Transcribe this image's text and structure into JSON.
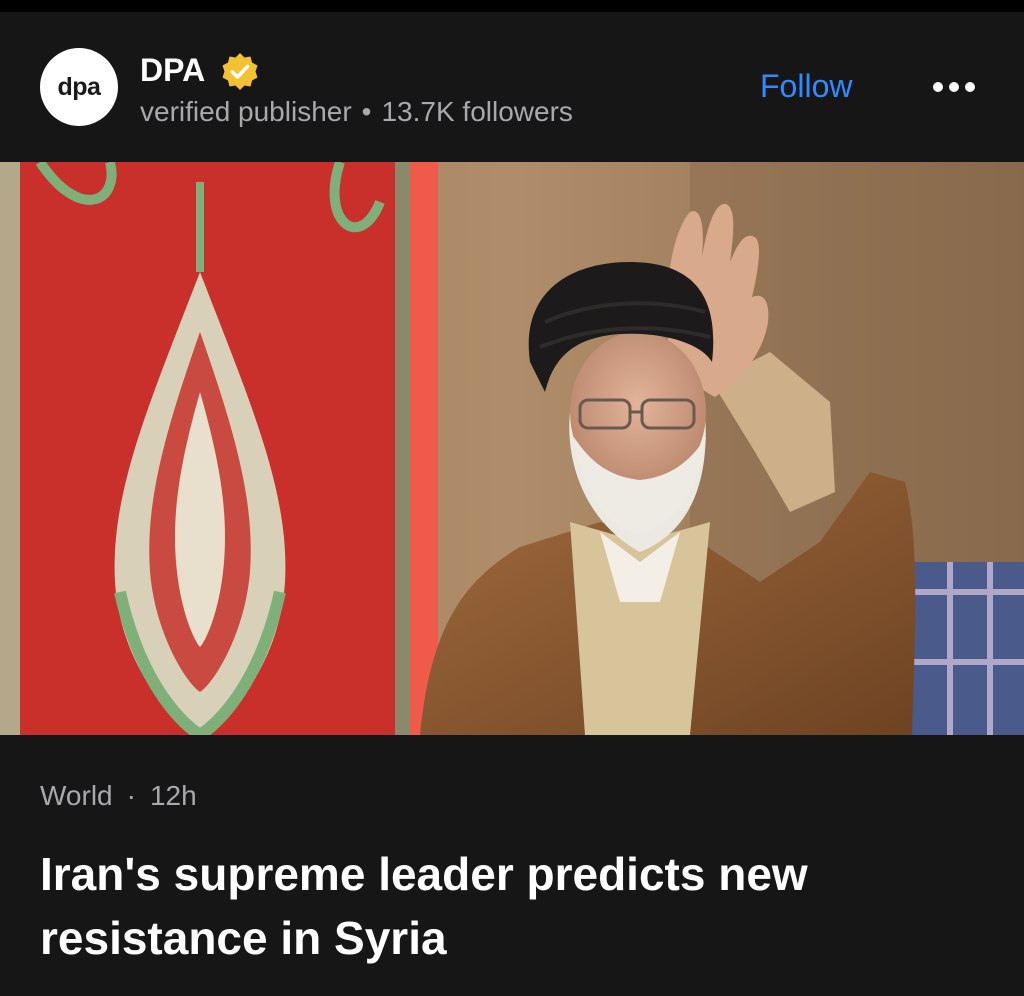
{
  "publisher": {
    "logo_text": "dpa",
    "name": "DPA",
    "verified_icon": "verified-badge-icon",
    "subtitle": "verified publisher",
    "followers": "13.7K followers",
    "follow_label": "Follow",
    "more_icon": "more-horizontal-icon"
  },
  "colors": {
    "background": "#161617",
    "accent": "#2f8cff",
    "badge": "#f2c230",
    "meta_text": "#a8a8ad"
  },
  "article": {
    "category": "World",
    "age": "12h",
    "headline": "Iran's supreme leader predicts new resistance in Syria"
  }
}
